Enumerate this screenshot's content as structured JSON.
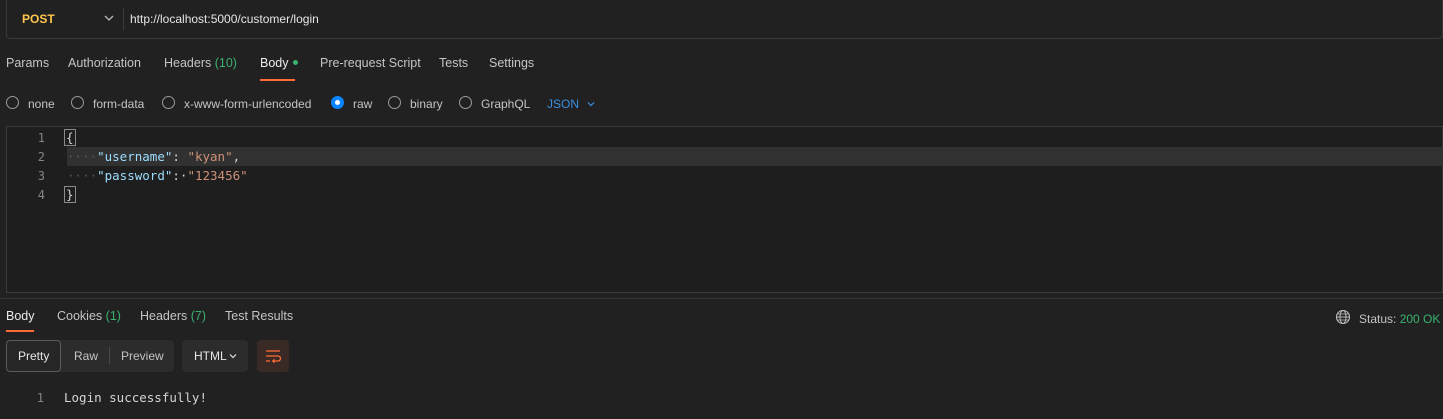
{
  "request": {
    "method": "POST",
    "url": "http://localhost:5000/customer/login"
  },
  "tabs": [
    {
      "label": "Params"
    },
    {
      "label": "Authorization"
    },
    {
      "label": "Headers",
      "count": "(10)"
    },
    {
      "label": "Body"
    },
    {
      "label": "Pre-request Script"
    },
    {
      "label": "Tests"
    },
    {
      "label": "Settings"
    }
  ],
  "body_types": {
    "options": [
      "none",
      "form-data",
      "x-www-form-urlencoded",
      "raw",
      "binary",
      "GraphQL"
    ],
    "selected": "raw",
    "format": "JSON"
  },
  "editor": {
    "line_numbers": [
      "1",
      "2",
      "3",
      "4"
    ],
    "open_brace": "{",
    "close_brace": "}",
    "fields": [
      {
        "key": "\"username\"",
        "value": "\"kyan\"",
        "trailing": ","
      },
      {
        "key": "\"password\"",
        "value": "\"123456\"",
        "trailing": ""
      }
    ]
  },
  "response_tabs": [
    {
      "label": "Body"
    },
    {
      "label": "Cookies",
      "count": "(1)"
    },
    {
      "label": "Headers",
      "count": "(7)"
    },
    {
      "label": "Test Results"
    }
  ],
  "status": {
    "label": "Status:",
    "value": "200 OK"
  },
  "view_modes": [
    "Pretty",
    "Raw",
    "Preview"
  ],
  "response_format": "HTML",
  "response": {
    "line_number": "1",
    "text": "Login successfully!"
  },
  "colors": {
    "accent": "#ff6c37",
    "method": "#ffc54d",
    "success": "#3bb26e",
    "link": "#3b8fe0"
  }
}
